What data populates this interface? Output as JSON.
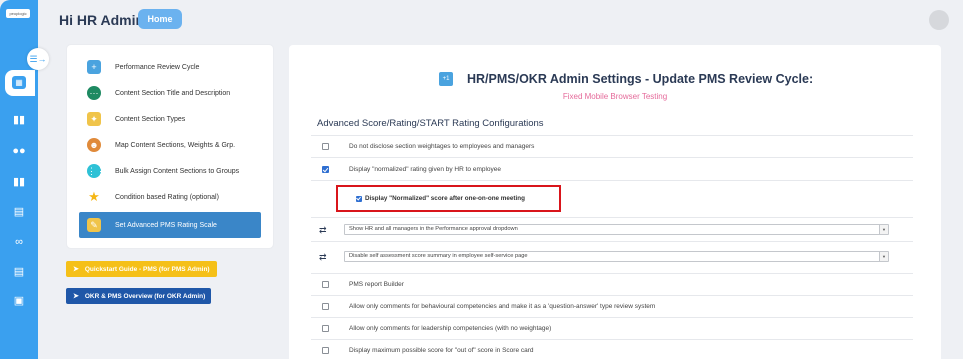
{
  "header": {
    "greeting": "Hi HR Admin",
    "home_label": "Home"
  },
  "logo_text": "peoplogic",
  "menu": {
    "items": [
      {
        "label": "Performance Review Cycle",
        "icon": "calendar-icon"
      },
      {
        "label": "Content Section Title and Description",
        "icon": "dots-icon"
      },
      {
        "label": "Content Section Types",
        "icon": "medal-icon"
      },
      {
        "label": "Map Content Sections, Weights & Grp.",
        "icon": "user-settings-icon"
      },
      {
        "label": "Bulk Assign Content Sections to Groups",
        "icon": "bulk-icon"
      },
      {
        "label": "Condition based Rating (optional)",
        "icon": "star-icon"
      },
      {
        "label": "Set Advanced PMS Rating Scale",
        "icon": "scale-icon",
        "active": true
      }
    ],
    "quickstart_label": "Quickstart Guide - PMS (for PMS Admin)",
    "overview_label": "OKR & PMS Overview (for OKR Admin)"
  },
  "main": {
    "title": "HR/PMS/OKR Admin Settings - Update PMS Review Cycle:",
    "subtitle": "Fixed Mobile Browser Testing",
    "section_heading": "Advanced Score/Rating/START Rating Configurations",
    "options": [
      {
        "label": "Do not disclose section weightages to employees and managers",
        "checked": false
      },
      {
        "label": "Display \"normalized\" rating given by HR to employee",
        "checked": true
      }
    ],
    "highlighted_option": {
      "label": "Display \"Normalized\" score after one-on-one meeting",
      "checked": true
    },
    "selects": [
      {
        "value": "Show HR and all managers in the Performance approval dropdown"
      },
      {
        "value": "Disable self assessment score summary in employee self-service page"
      }
    ],
    "more_options": [
      {
        "label": "PMS report Builder",
        "checked": false
      },
      {
        "label": "Allow only comments for behavioural competencies and make it as a 'question-answer' type review system",
        "checked": false
      },
      {
        "label": "Allow only comments for leadership competencies (with no weightage)",
        "checked": false
      },
      {
        "label": "Display maximum possible score for \"out of\" score in Score card",
        "checked": false
      }
    ]
  },
  "colors": {
    "rail": "#3aa0ef",
    "active_menu": "#3a86c8",
    "subtitle": "#e56a9a",
    "highlight_border": "#d9151b",
    "quickstart": "#f5c018",
    "overview": "#1f57a8"
  }
}
